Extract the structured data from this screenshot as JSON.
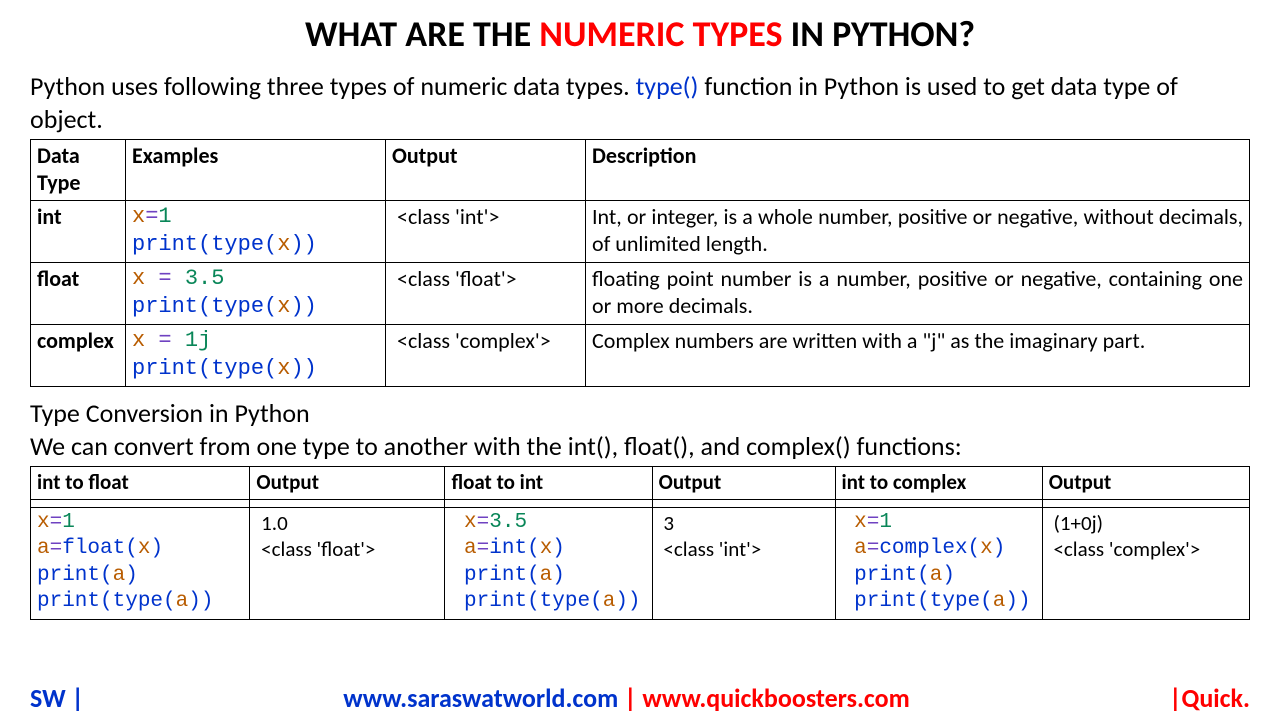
{
  "title": {
    "pre": "WHAT ARE THE ",
    "highlight": "NUMERIC TYPES",
    "post": " IN PYTHON?"
  },
  "intro": {
    "t1": "Python uses following three types of numeric data types. ",
    "fn": "type()",
    "t2": " function in Python is used to get data type of object."
  },
  "table1": {
    "h1": "Data Type",
    "h2": "Examples",
    "h3": "Output",
    "h4": "Description",
    "rows": [
      {
        "name": "int",
        "code": {
          "l1v": "x",
          "l1o": "=",
          "l1n": "1",
          "l2p": "print",
          "l2t": "type",
          "l2v": "x"
        },
        "out": "<class 'int'>",
        "desc": "Int, or integer, is a whole number, positive or negative, without decimals, of unlimited length."
      },
      {
        "name": "float",
        "code": {
          "l1v": "x",
          "l1o": " = ",
          "l1n": "3.5",
          "l2p": "print",
          "l2t": "type",
          "l2v": "x"
        },
        "out": "<class 'float'>",
        "desc": "floating point number is a number, positive or negative, containing one or more decimals."
      },
      {
        "name": "complex",
        "code": {
          "l1v": "x",
          "l1o": " = ",
          "l1n": "1j",
          "l2p": "print",
          "l2t": "type",
          "l2v": "x"
        },
        "out": "<class 'complex'>",
        "desc": "Complex numbers are written with a \"j\" as the imaginary part."
      }
    ]
  },
  "section2": {
    "title": "Type Conversion in Python",
    "sub": "We can convert from one type to another with the int(), float(), and complex() functions:"
  },
  "table2": {
    "h1": "int to float",
    "h2": "Output",
    "h3": "float to int",
    "h4": "Output",
    "h5": "int to complex",
    "h6": "Output",
    "c1": {
      "v": "x",
      "o": "=",
      "n": "1",
      "a": "a",
      "f": "float",
      "p": "print",
      "t": "type"
    },
    "o1": {
      "l1": "1.0",
      "l2": "<class 'float'>"
    },
    "c2": {
      "v": "x",
      "o": "=",
      "n": "3.5",
      "a": "a",
      "f": "int",
      "p": "print",
      "t": "type"
    },
    "o2": {
      "l1": "3",
      "l2": "<class 'int'>"
    },
    "c3": {
      "v": "x",
      "o": "=",
      "n": "1",
      "a": "a",
      "f": "complex",
      "p": "print",
      "t": "type"
    },
    "o3": {
      "l1": "(1+0j)",
      "l2": "<class 'complex'>"
    }
  },
  "footer": {
    "left": "SW |",
    "mid1": "www.saraswatworld.com",
    "sep": " | ",
    "mid2": "www.quickboosters.com",
    "right": "|Quick."
  }
}
